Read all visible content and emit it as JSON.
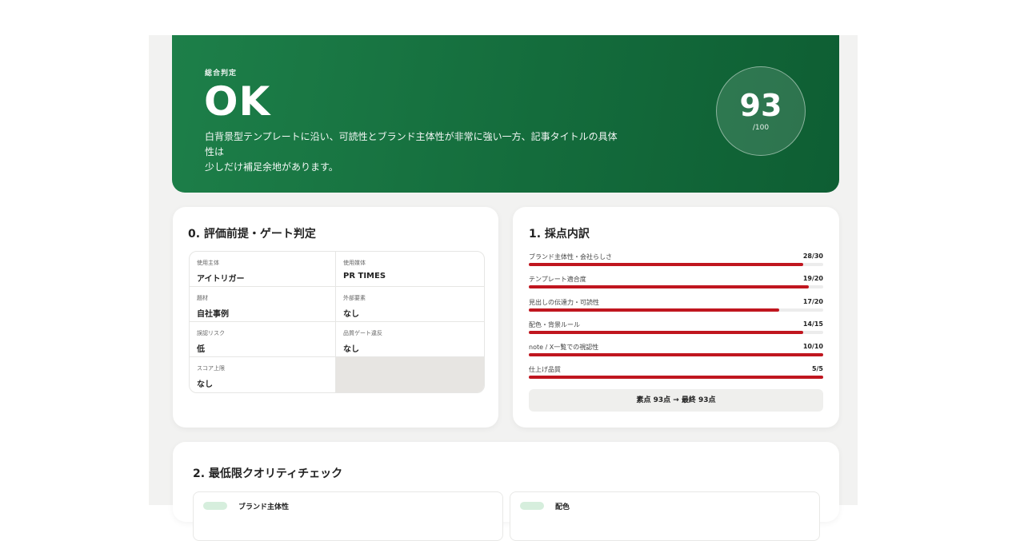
{
  "hero": {
    "eyebrow": "総合判定",
    "verdict": "OK",
    "summary_line1": "白背景型テンプレートに沿い、可読性とブランド主体性が非常に強い一方、記事タイトルの具体性は",
    "summary_line2": "少しだけ補足余地があります。",
    "score": "93",
    "score_max": "/100"
  },
  "gate": {
    "title": "0. 評価前提・ゲート判定",
    "cells": [
      {
        "key": "使用主体",
        "value": "アイトリガー"
      },
      {
        "key": "使用媒体",
        "value": "PR TIMES"
      },
      {
        "key": "題材",
        "value": "自社事例"
      },
      {
        "key": "外部要素",
        "value": "なし"
      },
      {
        "key": "誤認リスク",
        "value": "低"
      },
      {
        "key": "品質ゲート違反",
        "value": "なし"
      },
      {
        "key": "スコア上限",
        "value": "なし"
      }
    ]
  },
  "scores": {
    "title": "1. 採点内訳",
    "items": [
      {
        "label": "ブランド主体性・会社らしさ",
        "value": "28/30",
        "fraction": 0.933
      },
      {
        "label": "テンプレート適合度",
        "value": "19/20",
        "fraction": 0.95
      },
      {
        "label": "見出しの伝達力・可読性",
        "value": "17/20",
        "fraction": 0.85
      },
      {
        "label": "配色・背景ルール",
        "value": "14/15",
        "fraction": 0.933
      },
      {
        "label": "note / X一覧での視認性",
        "value": "10/10",
        "fraction": 1.0
      },
      {
        "label": "仕上げ品質",
        "value": "5/5",
        "fraction": 1.0
      }
    ],
    "total": "素点 93点 → 最終 93点"
  },
  "quality": {
    "title": "2. 最低限クオリティチェック",
    "items": [
      {
        "label": "ブランド主体性"
      },
      {
        "label": "配色"
      }
    ]
  },
  "colors": {
    "hero_green": "#146c3c",
    "bar_red": "#c0161f"
  }
}
